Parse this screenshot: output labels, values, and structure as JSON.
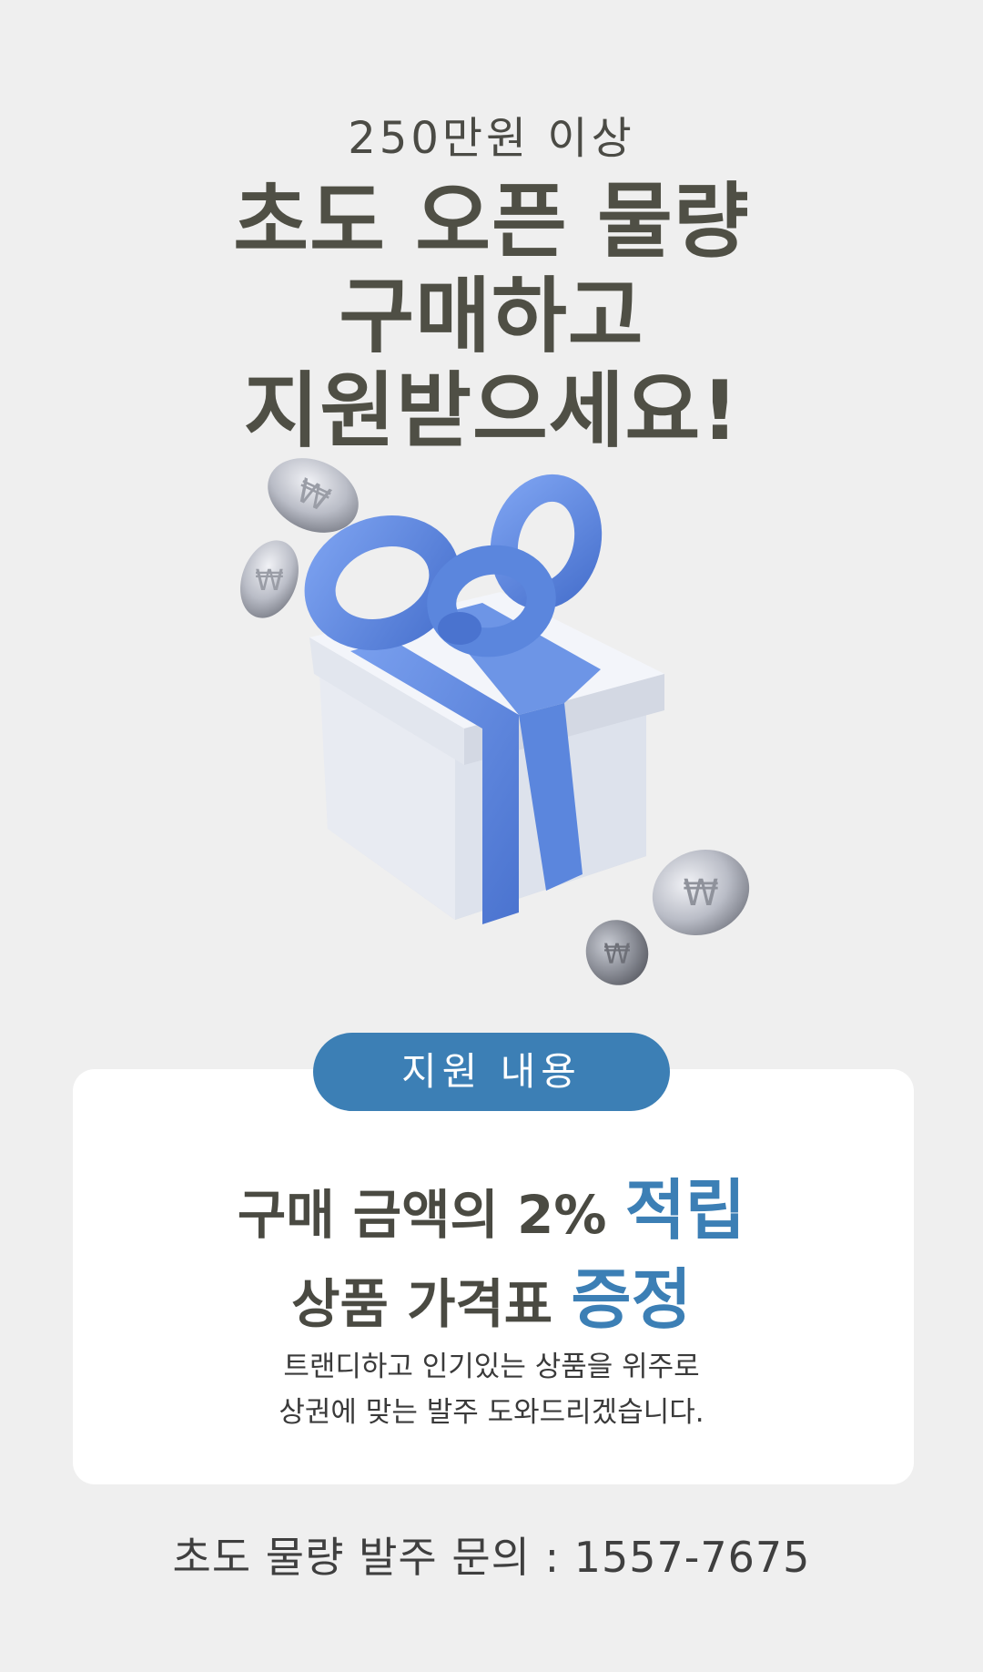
{
  "header": {
    "eyebrow": "250만원 이상",
    "headline_lines": [
      "초도 오픈 물량",
      "구매하고",
      "지원받으세요!"
    ]
  },
  "illustration": {
    "object": "gift-box-with-coins",
    "ribbon_color": "#5b86dd",
    "box_color": "#dfe4ee",
    "coin_color": "#b9bcc6",
    "coin_symbol": "₩"
  },
  "support": {
    "badge_label": "지원 내용",
    "benefit_1_prefix": "구매 금액의 2% ",
    "benefit_1_accent": "적립",
    "benefit_2_prefix": "상품 가격표 ",
    "benefit_2_accent": "증정",
    "description_lines": [
      "트랜디하고 인기있는 상품을 위주로",
      "상권에 맞는 발주 도와드리겠습니다."
    ]
  },
  "footer": {
    "inquiry": "초도 물량 발주 문의 : 1557-7675"
  },
  "colors": {
    "background": "#efefef",
    "accent": "#3c7fb5",
    "text_dark": "#4f4f45"
  }
}
